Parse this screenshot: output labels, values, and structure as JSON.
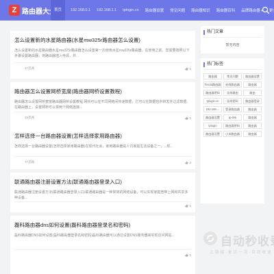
{
  "site": {
    "name": "路由器大全",
    "logo_letter": "Z"
  },
  "nav": [
    {
      "label": "首页"
    },
    {
      "label": "192.168.0.1"
    },
    {
      "label": "192.168.1.1"
    },
    {
      "label": "tplogin.cn"
    },
    {
      "label": "路由器设置"
    },
    {
      "label": "常见问题"
    },
    {
      "label": "路由器知识"
    },
    {
      "label": "路由器百科"
    },
    {
      "label": "品牌路由器"
    },
    {
      "label": "更多"
    }
  ],
  "articles": [
    {
      "title": "怎么设置新的水星路由器(水星mw325r路由器怎么设置)",
      "desc": "怎么设置新的水星路由器水星mw325r路由器怎么设置第一次使用水星mw325r路由器，在使用之前，您需要按照以下步骤设置路由器，将路由器插入电源，并...",
      "author": "",
      "views": "47次阅",
      "likes": "0"
    },
    {
      "title": "路由器怎么设置网桥宽度(路由器网桥设置教程)",
      "desc": "路由器怎么设置网桥宽度路由器网桥设置教程 网桥可以在不同网络间传递数据，它可以在数据包中转发并过滤数据。在路由器上，设置网桥可以将两个网络连接...",
      "author": "",
      "views": "49次阅",
      "likes": "0"
    },
    {
      "title": "怎样选择一台路由器设置(怎样选择家用路由器)",
      "desc": "怎样选择一台路由器设置(怎样选择家用路由器)在现代社会，家用路由器是人们家庭生活设备之一，...现...",
      "author": "",
      "views": "77次阅",
      "likes": "0"
    },
    {
      "title": "联通路由器注册设置方法(联通路由器登录入口)",
      "desc": "联通路由器注册设置方法(联通路由器登录入口)联通路由器是一种常常的网络设备，可以实现家庭宽带上网和共享多种设备...",
      "author": "",
      "views": "",
      "likes": "0"
    },
    {
      "title": "磊科路由器dns如何设置(磊科路由器登录名和密码)",
      "desc": "磊科路由器DNS如何设置(磊科路由器登录名和密码)磊科路由器可以通过设置DNS服务器来实现访问网站...",
      "author": "",
      "views": "",
      "likes": "0"
    }
  ],
  "sidebar": {
    "hot_title": "热门文章",
    "hot_empty": "暂无内容",
    "tags_title": "热门标签",
    "tags": [
      "路由器",
      "常见问题",
      "路由器设置",
      "Tenda路由器",
      "无线路由器",
      "路由器",
      "路由器密码",
      "无线路由",
      "路由",
      "tplogin.cn",
      "无线密码",
      "路由器登录",
      "192.168....",
      "登录路由器",
      "路由器",
      "路由器设置",
      "tp-link",
      "路由器",
      "tplogin",
      "路由器密码",
      "路由器",
      "路由器设置",
      "小米路由器",
      "路由器"
    ]
  },
  "watermark": {
    "text": "自动秒收录",
    "sub": "上 链 接 · 来 访 一 次 · 自 动 收 录"
  }
}
